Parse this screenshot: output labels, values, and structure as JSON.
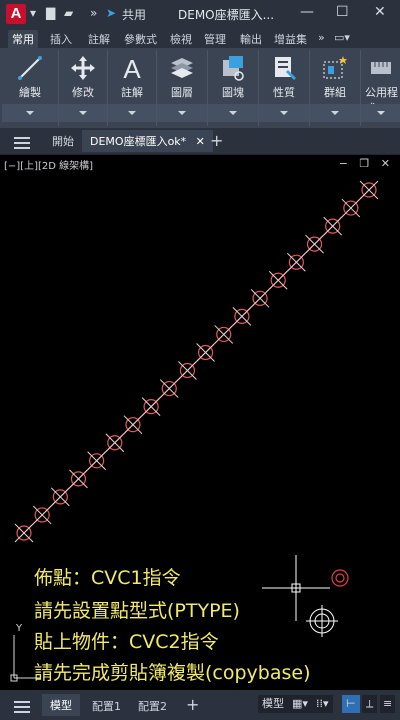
{
  "title_bar": {
    "app_letter": "A",
    "share_label": "共用",
    "window_title": "DEMO座標匯入...",
    "minimize": "—",
    "maximize": "☐",
    "close": "✕"
  },
  "ribbon_tabs": [
    "常用",
    "插入",
    "註解",
    "參數式",
    "檢視",
    "管理",
    "輸出",
    "增益集"
  ],
  "ribbon_panels": [
    {
      "label": "繪製"
    },
    {
      "label": "修改"
    },
    {
      "label": "註解"
    },
    {
      "label": "圖層"
    },
    {
      "label": "圖塊"
    },
    {
      "label": "性質"
    },
    {
      "label": "群組"
    },
    {
      "label": "公用程式"
    }
  ],
  "doc_tabs": {
    "start_label": "開始",
    "active_doc": "DEMO座標匯入ok*",
    "close_glyph": "✕",
    "plus": "+"
  },
  "viewport": {
    "label": "[−][上][2D 線架構]",
    "controls": "− ❐ ✕"
  },
  "notes": [
    "佈點：CVC1指令",
    "請先設置點型式(PTYPE)",
    "貼上物件：CVC2指令",
    "請先完成剪貼簿複製(copybase)"
  ],
  "ucs": {
    "y_label": "Y"
  },
  "status_bar": {
    "model_tab": "模型",
    "layout1": "配置1",
    "layout2": "配置2",
    "plus": "+",
    "model_btn": "模型"
  }
}
